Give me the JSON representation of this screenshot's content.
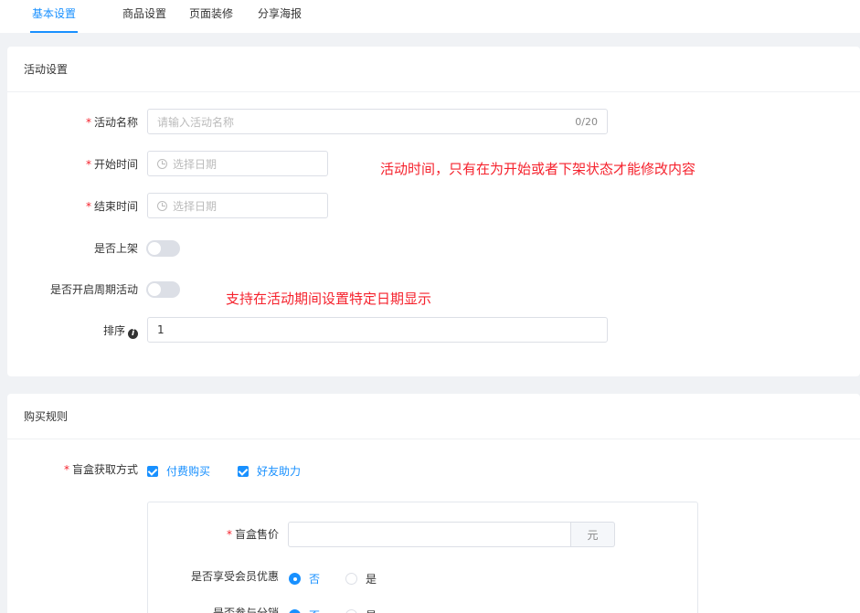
{
  "tabs": [
    "基本设置",
    "商品设置",
    "页面装修",
    "分享海报"
  ],
  "activity": {
    "title": "活动设置",
    "name_label": "活动名称",
    "name_placeholder": "请输入活动名称",
    "name_count": "0/20",
    "start_label": "开始时间",
    "start_placeholder": "选择日期",
    "end_label": "结束时间",
    "end_placeholder": "选择日期",
    "shelf_label": "是否上架",
    "cycle_label": "是否开启周期活动",
    "sort_label": "排序",
    "sort_value": "1",
    "note_time": "活动时间，只有在为开始或者下架状态才能修改内容",
    "note_cycle": "支持在活动期间设置特定日期显示"
  },
  "purchase": {
    "title": "购买规则",
    "method_label": "盲盒获取方式",
    "method_options": [
      "付费购买",
      "好友助力"
    ],
    "price_label": "盲盒售价",
    "price_suffix": "元",
    "member_label": "是否享受会员优惠",
    "member_options": [
      "否",
      "是"
    ],
    "dist_label": "是否参与分销",
    "dist_options": [
      "否",
      "是"
    ]
  },
  "colors": {
    "accent": "#1890ff",
    "required": "#f5222d",
    "note": "#f5222d"
  }
}
